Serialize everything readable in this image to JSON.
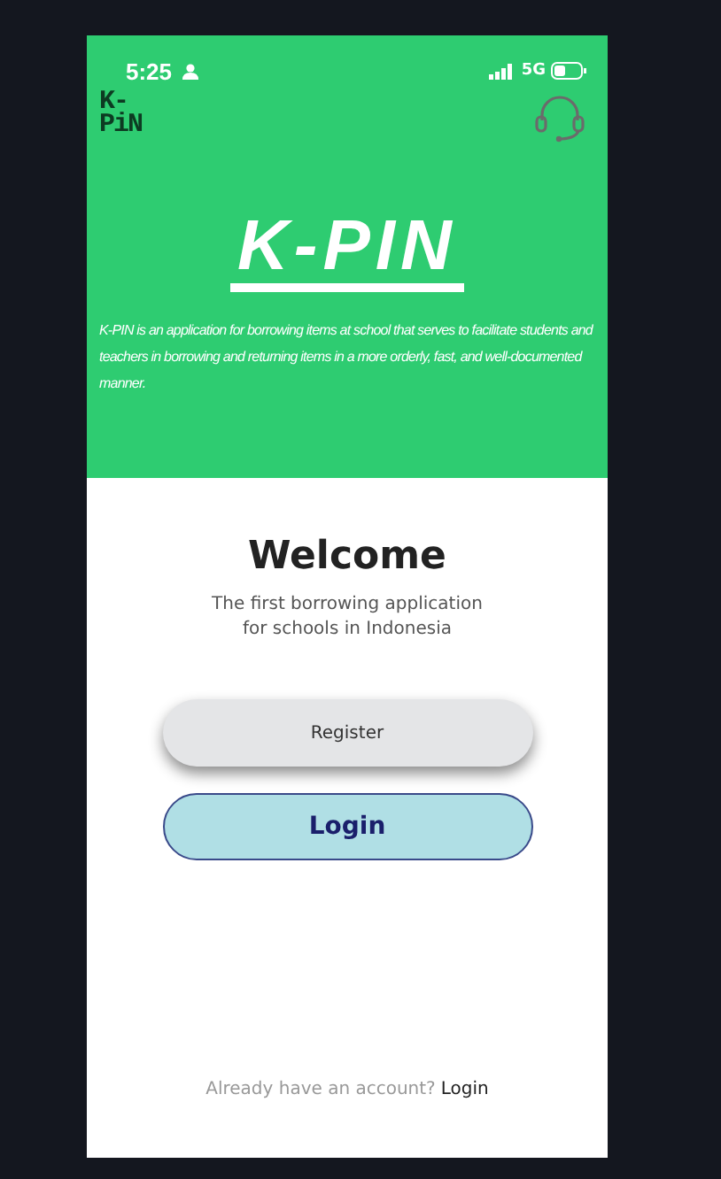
{
  "status_bar": {
    "time": "5:25",
    "network": "5G"
  },
  "header": {
    "logo_top": "K-",
    "logo_bottom": "PiN",
    "title": "K-PIN",
    "description": "K-PIN is an application for borrowing items at school that serves to facilitate students and teachers in borrowing and returning items in a more orderly, fast, and well-documented manner."
  },
  "welcome": {
    "title": "Welcome",
    "subtitle_lines": [
      "The first borrowing application",
      "for schools in Indonesia"
    ]
  },
  "buttons": [
    {
      "kind": "secondary",
      "label": "Register"
    },
    {
      "kind": "primary",
      "label": "Login"
    }
  ],
  "footer": {
    "prompt": "Already have an account?",
    "link": "Login"
  }
}
